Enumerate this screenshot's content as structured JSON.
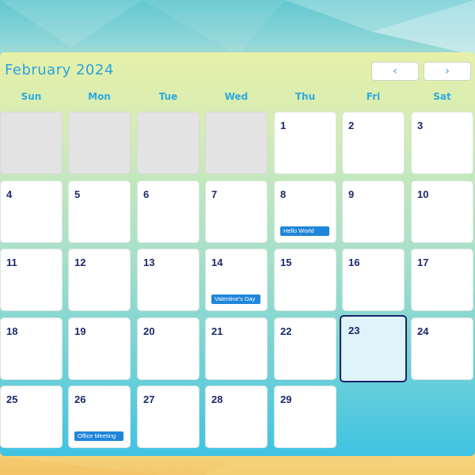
{
  "calendar": {
    "month_label": "February 2024",
    "prev_label": "‹",
    "next_label": "›",
    "weekdays": [
      "Sun",
      "Mon",
      "Tue",
      "Wed",
      "Thu",
      "Fri",
      "Sat"
    ],
    "leading_empty_days": 4,
    "days": [
      {
        "n": "1"
      },
      {
        "n": "2"
      },
      {
        "n": "3"
      },
      {
        "n": "4"
      },
      {
        "n": "5"
      },
      {
        "n": "6"
      },
      {
        "n": "7"
      },
      {
        "n": "8",
        "event": "Hello World"
      },
      {
        "n": "9"
      },
      {
        "n": "10"
      },
      {
        "n": "11"
      },
      {
        "n": "12"
      },
      {
        "n": "13"
      },
      {
        "n": "14",
        "event": "Valentine's Day"
      },
      {
        "n": "15"
      },
      {
        "n": "16"
      },
      {
        "n": "17"
      },
      {
        "n": "18"
      },
      {
        "n": "19"
      },
      {
        "n": "20"
      },
      {
        "n": "21"
      },
      {
        "n": "22"
      },
      {
        "n": "23",
        "today": true
      },
      {
        "n": "24"
      },
      {
        "n": "25"
      },
      {
        "n": "26",
        "event": "Office Meeting"
      },
      {
        "n": "27"
      },
      {
        "n": "28"
      },
      {
        "n": "29"
      }
    ],
    "colors": {
      "accent": "#2aa3e2",
      "day_number": "#1b2a6b",
      "event_chip": "#1f86da",
      "today_border": "#1a2466",
      "today_fill": "#dff3fb",
      "empty_cell": "#e3e3e3"
    }
  }
}
